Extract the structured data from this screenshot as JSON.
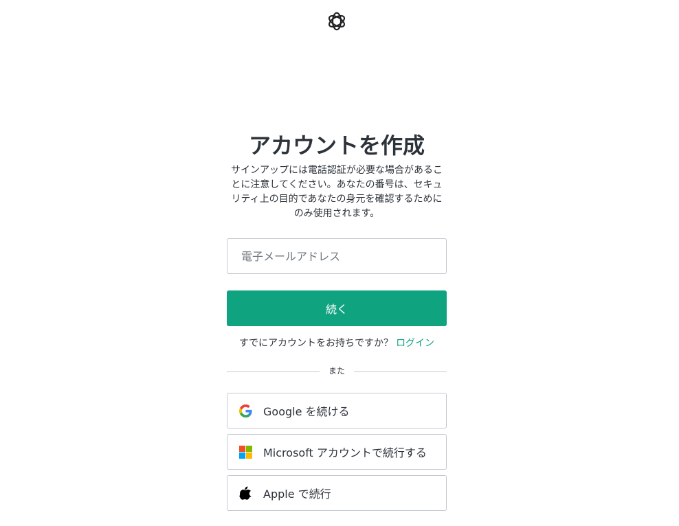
{
  "header": {
    "logo_icon": "openai-logo-icon"
  },
  "signup": {
    "title": "アカウントを作成",
    "subtitle": "サインアップには電話認証が必要な場合があることに注意してください。あなたの番号は、セキュリティ上の目的であなたの身元を確認するためにのみ使用されます。",
    "email_placeholder": "電子メールアドレス",
    "continue_label": "続く",
    "have_account_text": "すでにアカウントをお持ちですか？",
    "login_link": "ログイン",
    "divider_text": "また"
  },
  "social": {
    "google": {
      "label": "Google を続ける",
      "icon": "google-icon"
    },
    "microsoft": {
      "label": "Microsoft アカウントで続行する",
      "icon": "microsoft-icon"
    },
    "apple": {
      "label": "Apple で続行",
      "icon": "apple-icon"
    }
  },
  "colors": {
    "accent": "#10a37f",
    "text": "#2d333a",
    "border": "#c2c8d0",
    "placeholder": "#6f7780"
  }
}
